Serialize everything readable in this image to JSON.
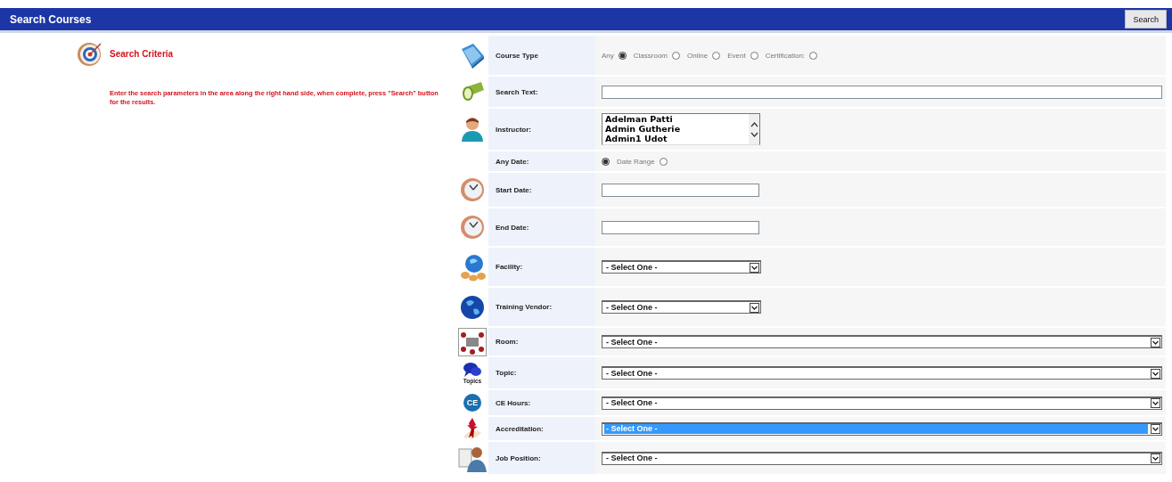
{
  "header": {
    "title": "Search Courses",
    "button": "Search"
  },
  "criteria": {
    "title": "Search Criteria",
    "text": "Enter the search parameters in the area along the right hand side, when complete, press \"Search\" button for the results."
  },
  "rows": [
    {
      "label": "Course Type",
      "kind": "radios",
      "options": [
        {
          "label": "Any",
          "selected": true
        },
        {
          "label": "Classroom",
          "selected": false
        },
        {
          "label": "Online",
          "selected": false
        },
        {
          "label": "Event",
          "selected": false
        },
        {
          "label": "Certification:",
          "selected": false
        }
      ]
    },
    {
      "label": "Search Text:",
      "kind": "text"
    },
    {
      "label": "Instructor:",
      "kind": "listbox",
      "items": [
        "Adelman Patti",
        "Admin Gutherie",
        "Admin1 Udot"
      ]
    },
    {
      "label": "Any Date:",
      "kind": "radios",
      "options": [
        {
          "selected": true
        },
        {
          "label": "Date Range",
          "selected": false
        }
      ]
    },
    {
      "label": "Start Date:",
      "kind": "text"
    },
    {
      "label": "End Date:",
      "kind": "text"
    },
    {
      "label": "Facility:",
      "kind": "select",
      "value": "- Select One -",
      "highlighted": false
    },
    {
      "label": "Training Vendor:",
      "kind": "select",
      "value": "- Select One -",
      "highlighted": false
    },
    {
      "label": "Room:",
      "kind": "select",
      "value": "- Select One -",
      "highlighted": false
    },
    {
      "icon_text": "Topics",
      "label": "Topic:",
      "kind": "select",
      "value": "- Select One -",
      "highlighted": false
    },
    {
      "icon_text": "CE",
      "label": "CE Hours:",
      "kind": "select",
      "value": "- Select One -",
      "highlighted": false
    },
    {
      "label": "Accreditation:",
      "kind": "select",
      "value": "- Select One -",
      "highlighted": true
    },
    {
      "label": "Job Position:",
      "kind": "select",
      "value": "- Select One -",
      "highlighted": false
    }
  ]
}
